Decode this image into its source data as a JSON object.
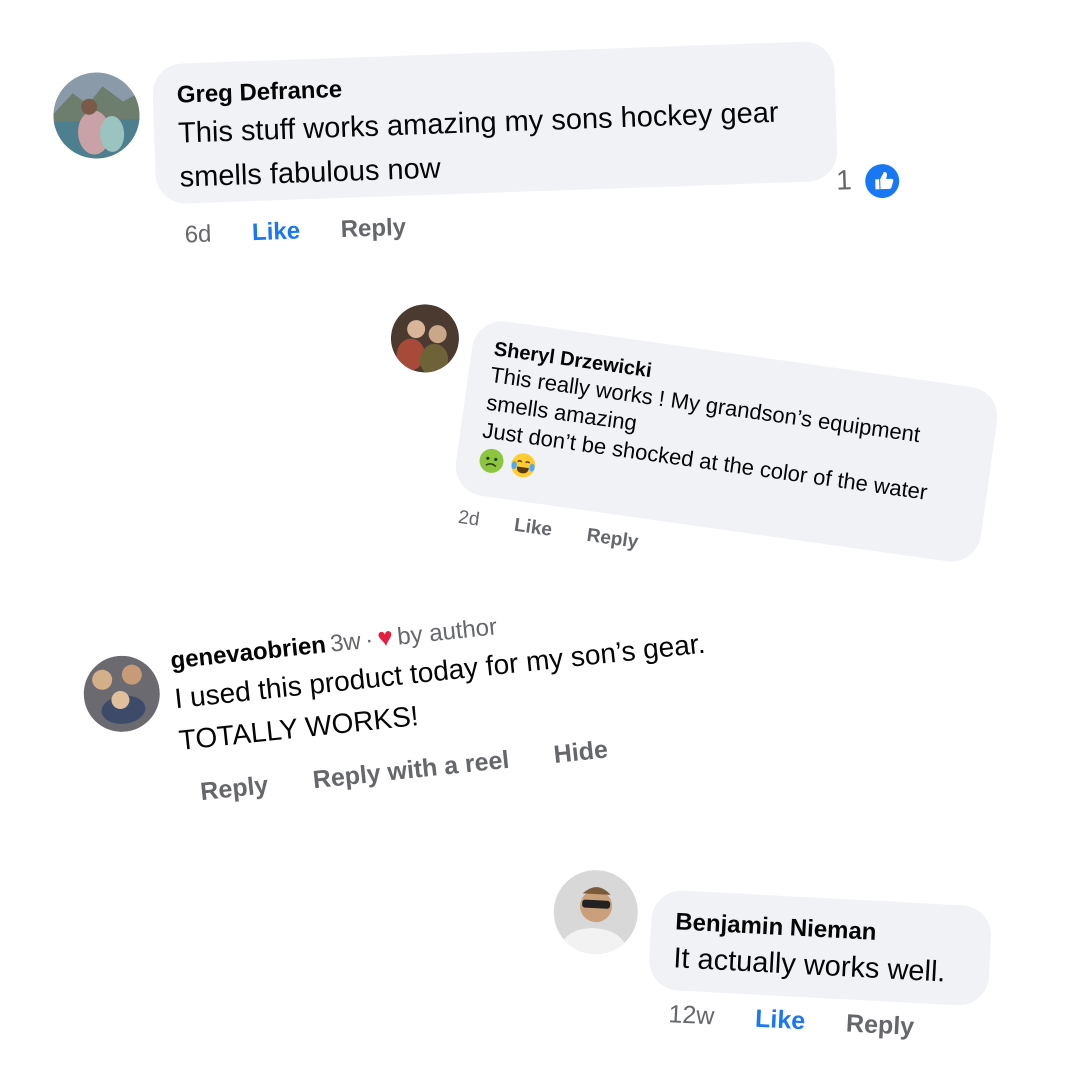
{
  "comments": [
    {
      "author": "Greg Defrance",
      "text_lines": [
        "This stuff works amazing my sons hockey gear",
        "smells fabulous now"
      ],
      "age": "6d",
      "like_label": "Like",
      "reply_label": "Reply",
      "reaction_count": "1",
      "reaction_icon": "thumbs-up-icon"
    },
    {
      "author": "Sheryl Drzewicki",
      "text_lines": [
        "This really works ! My grandson’s equipment",
        "smells amazing",
        "Just don’t be shocked at the color of the water"
      ],
      "emojis": [
        "nauseated-face-icon",
        "tears-of-joy-icon"
      ],
      "age": "2d",
      "like_label": "Like",
      "reply_label": "Reply"
    },
    {
      "author": "genevaobrien",
      "age": "3w",
      "separator": "·",
      "liked_by": "by author",
      "liked_icon": "heart-icon",
      "text_lines": [
        "I used this product today for my son’s gear.",
        "TOTALLY WORKS!"
      ],
      "reply_label": "Reply",
      "reply_reel_label": "Reply with a reel",
      "hide_label": "Hide"
    },
    {
      "author": "Benjamin Nieman",
      "text_lines": [
        "It actually works well."
      ],
      "age": "12w",
      "like_label": "Like",
      "reply_label": "Reply"
    }
  ],
  "colors": {
    "bubble": "#f0f2f5",
    "like_blue": "#1877f2",
    "muted": "#65676b",
    "heart": "#e41e3f"
  }
}
